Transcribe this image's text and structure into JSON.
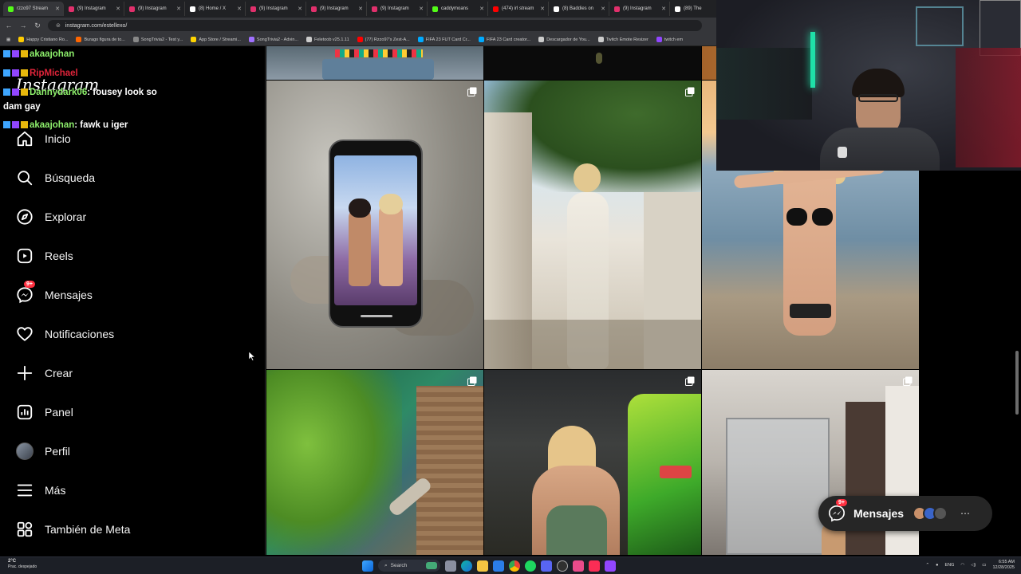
{
  "browser": {
    "tabs": [
      {
        "title": "rzzo97 Stream",
        "color": "#53fc18",
        "active": true
      },
      {
        "title": "(9) Instagram",
        "color": "#e1306c"
      },
      {
        "title": "(9) Instagram",
        "color": "#e1306c"
      },
      {
        "title": "(8) Home / X",
        "color": "#ffffff"
      },
      {
        "title": "(9) Instagram",
        "color": "#e1306c"
      },
      {
        "title": "(9) Instagram",
        "color": "#e1306c"
      },
      {
        "title": "(9) Instagram",
        "color": "#e1306c"
      },
      {
        "title": "caddymoans",
        "color": "#53fc18"
      },
      {
        "title": "(474) irl stream",
        "color": "#ff0000"
      },
      {
        "title": "(8) Baddies on",
        "color": "#ffffff"
      },
      {
        "title": "(9) Instagram",
        "color": "#e1306c"
      },
      {
        "title": "(89) The",
        "color": "#ffffff"
      }
    ],
    "url": "instagram.com/estellexo/",
    "bookmarks": [
      {
        "label": "Happy Cristiano Ro...",
        "color": "#ffcc00"
      },
      {
        "label": "Burago figura de to...",
        "color": "#ff6600"
      },
      {
        "label": "SongTrivia2 - Test y...",
        "color": "#888888"
      },
      {
        "label": "App Store / Streami...",
        "color": "#ffd400"
      },
      {
        "label": "SongTrivia2 - Advin...",
        "color": "#a070ff"
      },
      {
        "label": "Feletoob v25.1.11",
        "color": "#cccccc"
      },
      {
        "label": "(77) Rzzo97's Zest-A...",
        "color": "#ff0000"
      },
      {
        "label": "FIFA 23 FUT Card Cr...",
        "color": "#00aaff"
      },
      {
        "label": "FIFA 23 Card creator...",
        "color": "#00aaff"
      },
      {
        "label": "Descargador de You...",
        "color": "#cccccc"
      },
      {
        "label": "Twitch Emote Resizer",
        "color": "#cccccc"
      },
      {
        "label": "twitch em",
        "color": "#9146ff"
      }
    ]
  },
  "sidebar": {
    "logo": "Instagram",
    "items": [
      {
        "label": "Inicio",
        "icon": "home-icon"
      },
      {
        "label": "Búsqueda",
        "icon": "search-icon"
      },
      {
        "label": "Explorar",
        "icon": "compass-icon"
      },
      {
        "label": "Reels",
        "icon": "reels-icon"
      },
      {
        "label": "Mensajes",
        "icon": "messenger-icon",
        "badge": "9+"
      },
      {
        "label": "Notificaciones",
        "icon": "heart-icon"
      },
      {
        "label": "Crear",
        "icon": "plus-icon"
      },
      {
        "label": "Panel",
        "icon": "dashboard-icon"
      },
      {
        "label": "Perfil",
        "icon": "avatar-icon"
      },
      {
        "label": "Más",
        "icon": "menu-icon"
      },
      {
        "label": "También de Meta",
        "icon": "meta-apps-icon"
      }
    ]
  },
  "chat": [
    {
      "user": "akaajohan",
      "text": "",
      "user_color": "#8ef06c"
    },
    {
      "user": "RipMichael",
      "text": "",
      "user_color": "#e0243a"
    },
    {
      "user": "Dannydark06",
      "text": ": fousey look so",
      "user_color": "#8ef06c"
    },
    {
      "user": "",
      "text": "dam gay",
      "user_color": "#ffffff"
    },
    {
      "user": "akaajohan",
      "text": ": fawk u iger",
      "user_color": "#8ef06c"
    }
  ],
  "messages_pill": {
    "label": "Mensajes",
    "badge": "9+"
  },
  "taskbar": {
    "weather_temp": "2°C",
    "weather_desc": "Prac. despejado",
    "search": "Search",
    "lang": "ENG",
    "time": "6:55 AM",
    "date": "12/28/2025"
  }
}
